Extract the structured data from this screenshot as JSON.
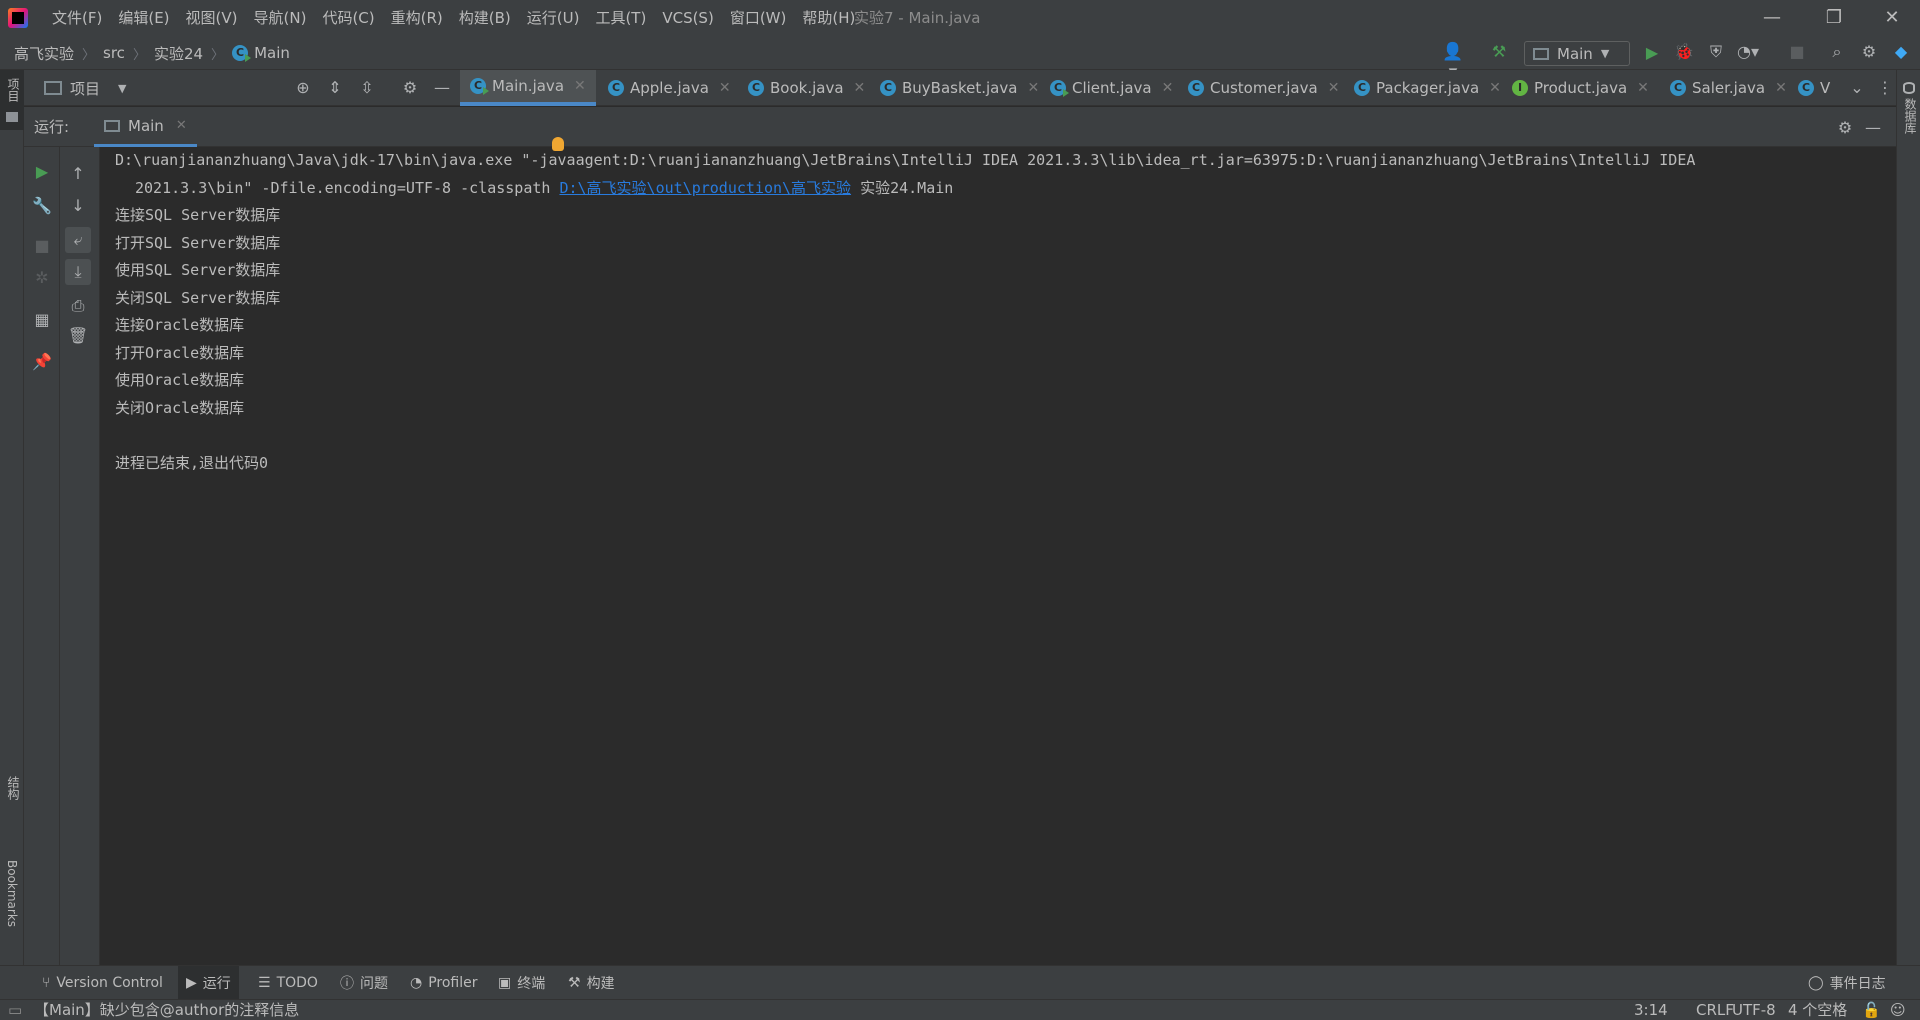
{
  "menu": [
    "文件(F)",
    "编辑(E)",
    "视图(V)",
    "导航(N)",
    "代码(C)",
    "重构(R)",
    "构建(B)",
    "运行(U)",
    "工具(T)",
    "VCS(S)",
    "窗口(W)",
    "帮助(H)"
  ],
  "window_title": "实验7 - Main.java",
  "window_controls": {
    "minimize": "—",
    "restore": "❐",
    "close": "✕"
  },
  "breadcrumb": {
    "project": "高飞实验",
    "src": "src",
    "package": "实验24",
    "class": "Main"
  },
  "run_config": {
    "label": "Main"
  },
  "left_stripe": {
    "project": "项目",
    "structure": "结构",
    "bookmarks": "Bookmarks"
  },
  "right_stripe": {
    "database": "数据库"
  },
  "project_panel": {
    "label": "项目"
  },
  "tabs": [
    {
      "label": "Main.java",
      "icon": "C"
    },
    {
      "label": "Apple.java",
      "icon": "C"
    },
    {
      "label": "Book.java",
      "icon": "C"
    },
    {
      "label": "BuyBasket.java",
      "icon": "C"
    },
    {
      "label": "Client.java",
      "icon": "C"
    },
    {
      "label": "Customer.java",
      "icon": "C"
    },
    {
      "label": "Packager.java",
      "icon": "C"
    },
    {
      "label": "Product.java",
      "icon": "I"
    },
    {
      "label": "Saler.java",
      "icon": "C"
    },
    {
      "label": "V",
      "icon": "C"
    }
  ],
  "run_panel": {
    "label": "运行:",
    "tab": "Main"
  },
  "console": {
    "cmd_part1": "D:\\ruanjiananzhuang\\Java\\jdk-17\\bin\\java.exe \"-javaagent:D:\\ruanjiananzhuang\\JetBrains\\IntelliJ IDEA 2021.3.3\\lib\\idea_rt.jar=63975:D:\\ruanjiananzhuang\\JetBrains\\IntelliJ IDEA",
    "cmd_part2": "2021.3.3\\bin\" -Dfile.encoding=UTF-8 -classpath ",
    "cmd_link": "D:\\高飞实验\\out\\production\\高飞实验",
    "cmd_part3": " 实验24.Main",
    "lines": [
      "连接SQL Server数据库",
      "打开SQL Server数据库",
      "使用SQL Server数据库",
      "关闭SQL Server数据库",
      "连接Oracle数据库",
      "打开Oracle数据库",
      "使用Oracle数据库",
      "关闭Oracle数据库"
    ],
    "exit_line": "进程已结束,退出代码0"
  },
  "bottom_tools": {
    "version_control": "Version Control",
    "run": "运行",
    "todo": "TODO",
    "problems": "问题",
    "profiler": "Profiler",
    "terminal": "终端",
    "build": "构建",
    "event_log": "事件日志"
  },
  "status": {
    "message": "【Main】缺少包含@author的注释信息",
    "position": "3:14",
    "line_sep": "CRLF",
    "encoding": "UTF-8",
    "indent": "4 个空格"
  }
}
